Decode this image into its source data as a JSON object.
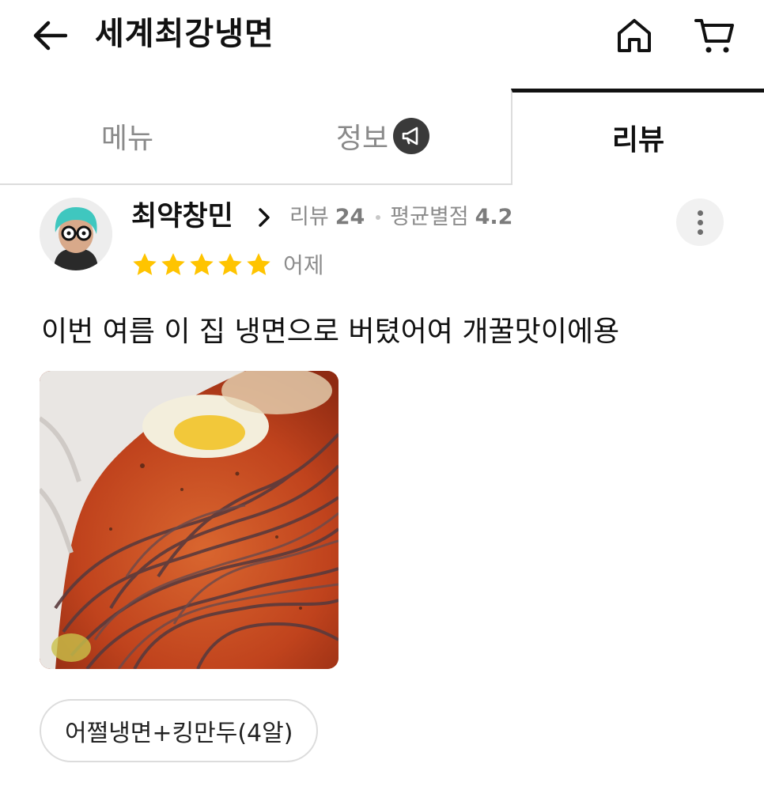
{
  "header": {
    "title": "세계최강냉면"
  },
  "tabs": [
    {
      "label": "메뉴"
    },
    {
      "label": "정보"
    },
    {
      "label": "리뷰"
    }
  ],
  "review": {
    "reviewer_name": "최약창민",
    "review_count_label": "리뷰",
    "review_count": "24",
    "avg_rating_label": "평균별점",
    "avg_rating": "4.2",
    "star_rating": 5,
    "date": "어제",
    "text": "이번 여름 이 집 냉면으로 버텼어여 개꿀맛이에용",
    "ordered_menu": "어쩔냉면+킹만두(4알)"
  },
  "colors": {
    "star": "#FFC400",
    "active_tab": "#111111",
    "inactive_tab": "#8A8A8A",
    "meta_text": "#8C8C8C"
  }
}
